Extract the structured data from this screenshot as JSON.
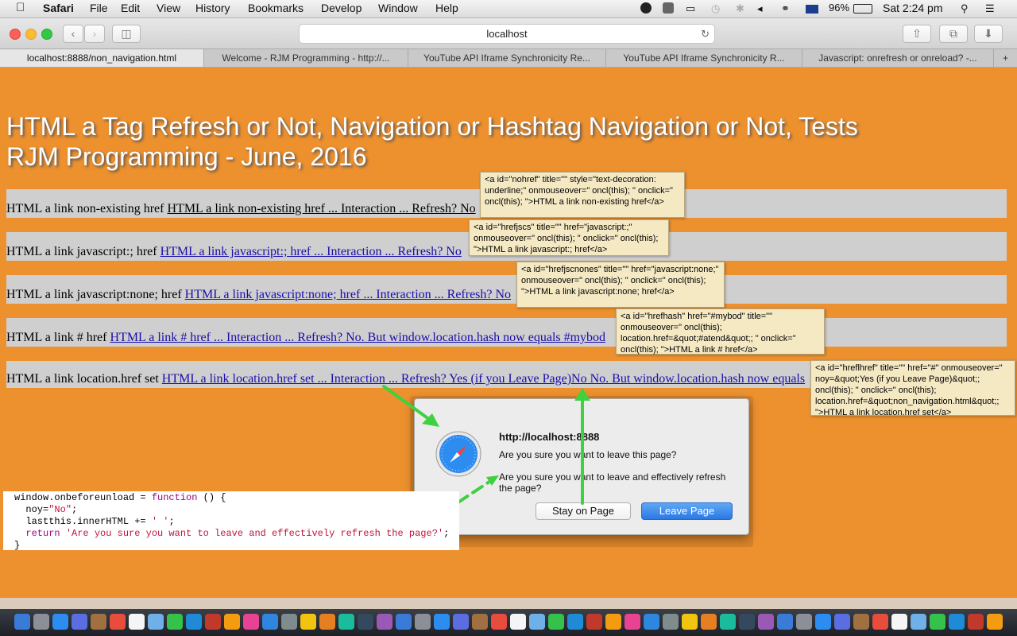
{
  "menubar": {
    "app": "Safari",
    "items": [
      "File",
      "Edit",
      "View",
      "History",
      "Bookmarks",
      "Develop",
      "Window",
      "Help"
    ],
    "battery": "96%",
    "clock": "Sat 2:24 pm"
  },
  "browser": {
    "address": "localhost",
    "tabs": [
      "localhost:8888/non_navigation.html",
      "Welcome - RJM Programming - http://...",
      "YouTube API Iframe Synchronicity Re...",
      "YouTube API Iframe Synchronicity R...",
      "Javascript: onrefresh or onreload? -..."
    ],
    "new_tab": "+"
  },
  "page": {
    "title_line1": "HTML a Tag Refresh or Not, Navigation or Hashtag Navigation or Not, Tests",
    "title_line2": "RJM Programming - June, 2016",
    "rows": [
      {
        "label": "HTML a link non-existing href ",
        "link": "HTML a link non-existing href ... Interaction ... Refresh? No"
      },
      {
        "label": "HTML a link javascript:; href ",
        "link": "HTML a link javascript:; href ... Interaction ... Refresh? No"
      },
      {
        "label": "HTML a link javascript:none; href ",
        "link": "HTML a link javascript:none; href ... Interaction ... Refresh? No"
      },
      {
        "label": "HTML a link # href ",
        "link": "HTML a link # href ... Interaction ... Refresh? No. But window.location.hash now equals #mybod"
      },
      {
        "label": "HTML a link location.href set ",
        "link": "HTML a link location.href set ... Interaction ... Refresh? Yes (if you Leave Page)No No. But window.location.hash now equals"
      }
    ],
    "tooltips": [
      "<a id=\"nohref\" title=\"\" style=\"text-decoration: underline;\" onmouseover=\" oncl(this); \" onclick=\" oncl(this); \">HTML a link non-existing href</a>",
      "<a id=\"hrefjscs\" title=\"\" href=\"javascript:;\" onmouseover=\" oncl(this); \" onclick=\" oncl(this); \">HTML a link javascript:; href</a>",
      "<a id=\"hrefjscnones\" title=\"\" href=\"javascript:none;\" onmouseover=\" oncl(this); \" onclick=\" oncl(this); \">HTML a link javascript:none; href</a>",
      "<a id=\"hrefhash\" href=\"#mybod\" title=\"\" onmouseover=\" oncl(this); location.href=&quot;#atend&quot;;  \" onclick=\" oncl(this); \">HTML a link # href</a>",
      "<a id=\"hreflhref\" title=\"\" href=\"#\" onmouseover=\"   noy=&quot;Yes (if you Leave Page)&quot;; oncl(this); \" onclick=\" oncl(this); location.href=&quot;non_navigation.html&quot;; \">HTML a link location.href set</a>"
    ]
  },
  "dialog": {
    "host": "http://localhost:8888",
    "question": "Are you sure you want to leave this page?",
    "message": "Are you sure you want to leave and effectively refresh the page?",
    "stay_label": "Stay on Page",
    "leave_label": "Leave Page"
  },
  "code": {
    "line1a": "window.onbeforeunload = ",
    "line1kw": "function",
    "line1b": " () {",
    "line2a": "  noy=",
    "line2s": "\"No\"",
    "line2b": ";",
    "line3a": "  lastthis.innerHTML += ",
    "line3s": "' '",
    "line3b": ";",
    "line4kw": "  return ",
    "line4s": "'Are you sure you want to leave and effectively refresh the page?'",
    "line4b": ";",
    "line5": "}"
  },
  "colors": {
    "page_bg": "#ed902e",
    "row_bg": "#cfcfcf",
    "tooltip_bg": "#f5e9c4",
    "arrow": "#3fd13f",
    "leave_button": "#2a78e4"
  }
}
